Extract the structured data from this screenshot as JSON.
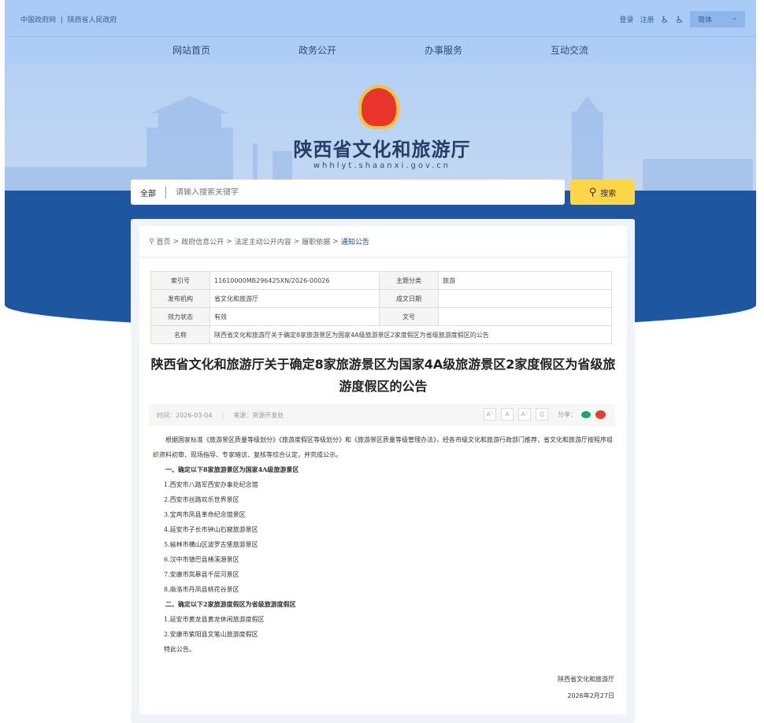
{
  "topbar": {
    "gov_link": "中国政府网",
    "sep": "|",
    "province_link": "陕西省人民政府",
    "login": "登录",
    "register": "注册",
    "lang": "简体"
  },
  "nav": [
    "网站首页",
    "政务公开",
    "办事服务",
    "互动交流"
  ],
  "header": {
    "title": "陕西省文化和旅游厅",
    "url": "whhlyt.shaanxi.gov.cn"
  },
  "search": {
    "scope": "全部",
    "placeholder": "请输入搜索关键字",
    "button": "搜索"
  },
  "breadcrumb": [
    "首页",
    "政府信息公开",
    "法定主动公开内容",
    "履职依据",
    "通知公告"
  ],
  "info": {
    "index_label": "索引号",
    "index": "11610000MB296425XN/2026-00026",
    "topic_label": "主题分类",
    "topic": "旅游",
    "org_label": "发布机构",
    "org": "省文化和旅游厅",
    "date_label": "成文日期",
    "date": "",
    "status_label": "效力状态",
    "status": "有效",
    "doc_label": "文号",
    "doc": "",
    "name_label": "名称",
    "name": "陕西省文化和旅游厅关于确定8家旅游景区为国家4A级旅游景区2家度假区为省级旅游度假区的公告"
  },
  "article": {
    "title": "陕西省文化和旅游厅关于确定8家旅游景区为国家4A级旅游景区2家度假区为省级旅游度假区的公告",
    "time": "时间：2026-03-04",
    "source": "来源：资源开发处",
    "share": "分享：",
    "intro": "根据国家标准《旅游景区质量等级划分》《旅游度假区等级划分》和《旅游景区质量等级管理办法》，经各市级文化和旅游行政部门推荐，省文化和旅游厅按程序组织资料初审、现场指导、专家暗访、复核等综合认定，并完成公示。",
    "h1": "一、确定以下8家旅游景区为国家4A级旅游景区",
    "list1": [
      "1.西安市八路军西安办事处纪念馆",
      "2.西安市丝路欢乐世界景区",
      "3.宝鸡市凤县革命纪念馆景区",
      "4.延安市子长市钟山石窟旅游景区",
      "5.榆林市横山区波罗古堡旅游景区",
      "6.汉中市镇巴县楮溪源景区",
      "7.安康市岚皋县千层河景区",
      "8.商洛市丹凤县桃花谷景区"
    ],
    "h2": "二、确定以下2家旅游度假区为省级旅游度假区",
    "list2": [
      "1.延安市黄龙县黄龙休闲旅游度假区",
      "2.安康市紫阳县文笔山旅游度假区"
    ],
    "closing": "特此公告。",
    "signer": "陕西省文化和旅游厅",
    "sign_date": "2026年2月27日"
  },
  "colors": {
    "band": "#1f56a0",
    "search_button": "#fdd549",
    "topbar": "#a9cbf6"
  }
}
